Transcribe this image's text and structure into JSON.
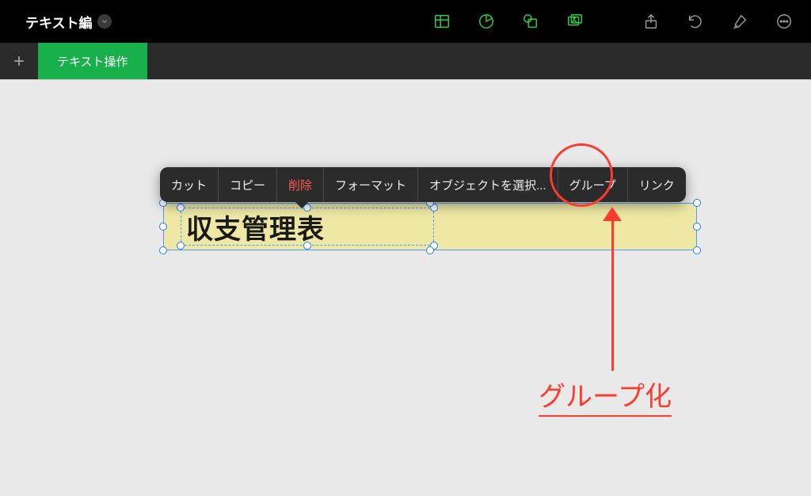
{
  "header": {
    "doc_title": "テキスト編"
  },
  "tabs": {
    "active_label": "テキスト操作"
  },
  "context_menu": {
    "cut": "カット",
    "copy": "コピー",
    "delete": "削除",
    "format": "フォーマット",
    "select_objects": "オブジェクトを選択...",
    "group": "グループ",
    "link": "リンク"
  },
  "text_object": {
    "content": "収支管理表"
  },
  "annotation": {
    "label": "グループ化"
  },
  "icons": {
    "back": "chevron-left",
    "table": "table",
    "chart": "pie-chart",
    "shape": "shapes",
    "media": "media",
    "share": "share",
    "undo": "undo",
    "format_brush": "paint-brush",
    "more": "ellipsis-circle"
  }
}
